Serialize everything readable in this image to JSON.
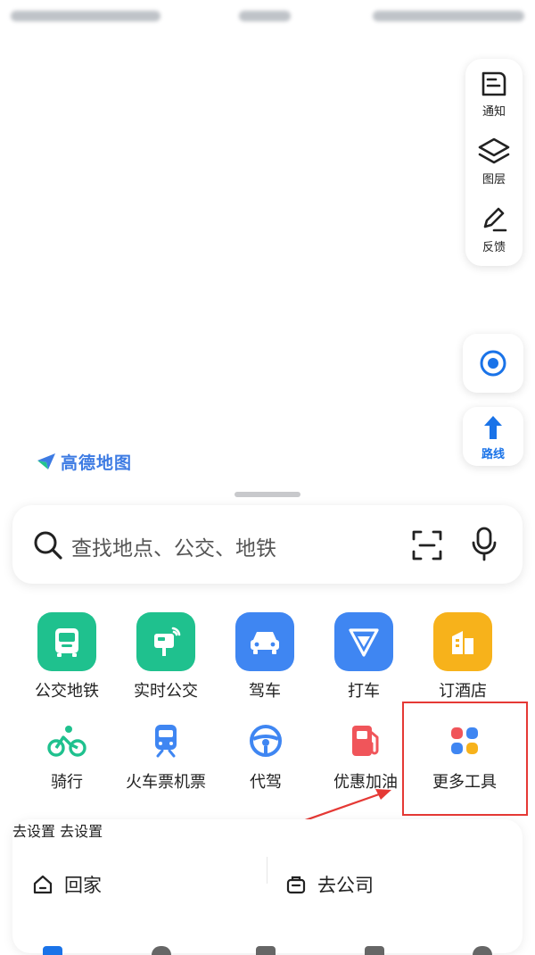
{
  "map": {
    "tools": [
      {
        "label": "通知",
        "icon": "notice-icon"
      },
      {
        "label": "图层",
        "icon": "layers-icon"
      },
      {
        "label": "反馈",
        "icon": "feedback-icon"
      }
    ],
    "route_label": "路线",
    "logo_text": "高德地图"
  },
  "search": {
    "placeholder": "查找地点、公交、地铁"
  },
  "main_services": [
    {
      "label": "公交地铁",
      "color": "#1fc18e"
    },
    {
      "label": "实时公交",
      "color": "#1fc18e"
    },
    {
      "label": "驾车",
      "color": "#3f86f2"
    },
    {
      "label": "打车",
      "color": "#3f86f2"
    },
    {
      "label": "订酒店",
      "color": "#f7b21b"
    }
  ],
  "tools": [
    {
      "label": "骑行",
      "icon": "bike-icon"
    },
    {
      "label": "火车票机票",
      "icon": "train-icon"
    },
    {
      "label": "代驾",
      "icon": "steering-wheel-icon"
    },
    {
      "label": "优惠加油",
      "icon": "fuel-icon"
    },
    {
      "label": "更多工具",
      "icon": "more-tools-icon"
    }
  ],
  "favorites": {
    "home": {
      "label": "回家",
      "action": "去设置"
    },
    "company": {
      "label": "去公司",
      "action": "去设置"
    }
  },
  "colors": {
    "accent": "#1a73e8",
    "green": "#1fc18e",
    "blue": "#3f86f2",
    "orange": "#f7b21b",
    "annotation": "#e53935"
  }
}
